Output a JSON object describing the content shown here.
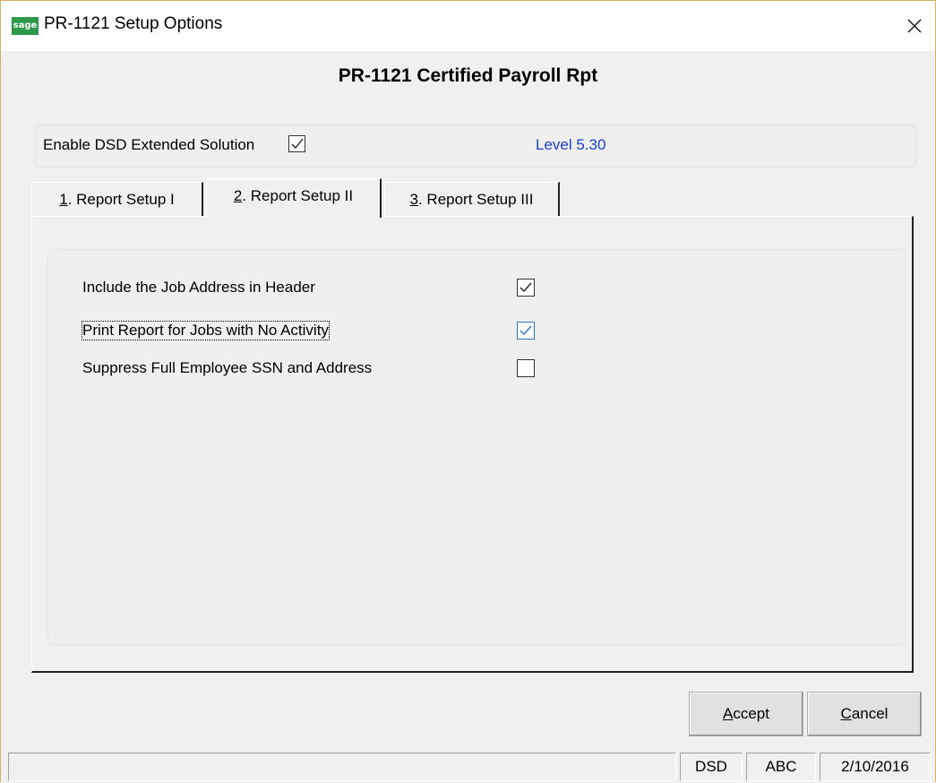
{
  "window": {
    "title": "PR-1121 Setup Options",
    "logo_text": "sage"
  },
  "form": {
    "title": "PR-1121 Certified Payroll Rpt",
    "enable_label": "Enable DSD Extended Solution",
    "enable_checked": true,
    "level": "Level  5.30"
  },
  "tabs": [
    {
      "number": "1",
      "label": ". Report Setup I",
      "active": false
    },
    {
      "number": "2",
      "label": ". Report Setup II",
      "active": true
    },
    {
      "number": "3",
      "label": ". Report Setup III",
      "active": false
    }
  ],
  "options": [
    {
      "label": "Include the Job Address in Header",
      "checked": true
    },
    {
      "label": "Print Report for Jobs with No Activity",
      "checked": true
    },
    {
      "label": "Suppress Full Employee SSN and Address",
      "checked": false
    }
  ],
  "buttons": {
    "accept_hotkey": "A",
    "accept_rest": "ccept",
    "cancel_hotkey": "C",
    "cancel_rest": "ancel"
  },
  "status": {
    "segment1": "DSD",
    "segment2": "ABC",
    "date": "2/10/2016"
  }
}
